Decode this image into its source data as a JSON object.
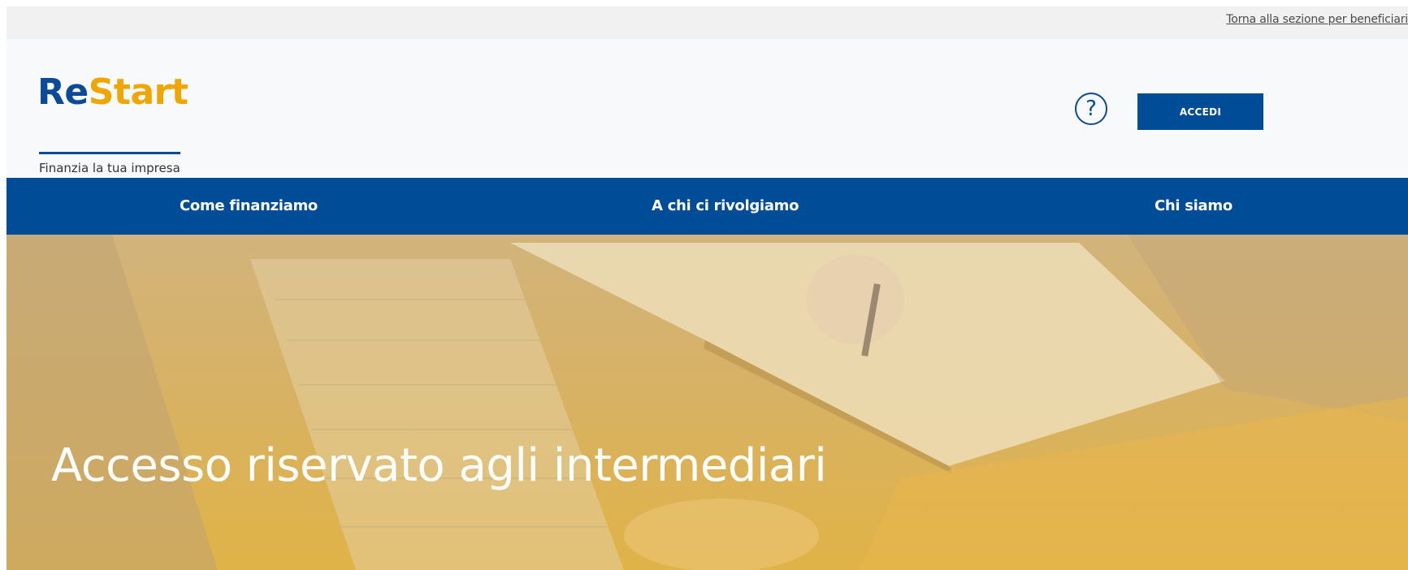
{
  "topbar": {
    "back_link": "Torna alla sezione per beneficiari"
  },
  "header": {
    "logo": {
      "word_part1": "Re",
      "word_part2": "Start",
      "tagline": "Finanzia la tua impresa"
    },
    "help_icon": "question-circle-icon",
    "help_glyph": "?",
    "login_label": "ACCEDI"
  },
  "nav": {
    "items": [
      {
        "label": "Come finanziamo"
      },
      {
        "label": "A chi ci rivolgiamo"
      },
      {
        "label": "Chi siamo"
      }
    ]
  },
  "hero": {
    "title": "Accesso riservato agli intermediari"
  },
  "colors": {
    "primary": "#004c97",
    "accent": "#f0a500",
    "hero_overlay": "#dcb250"
  }
}
